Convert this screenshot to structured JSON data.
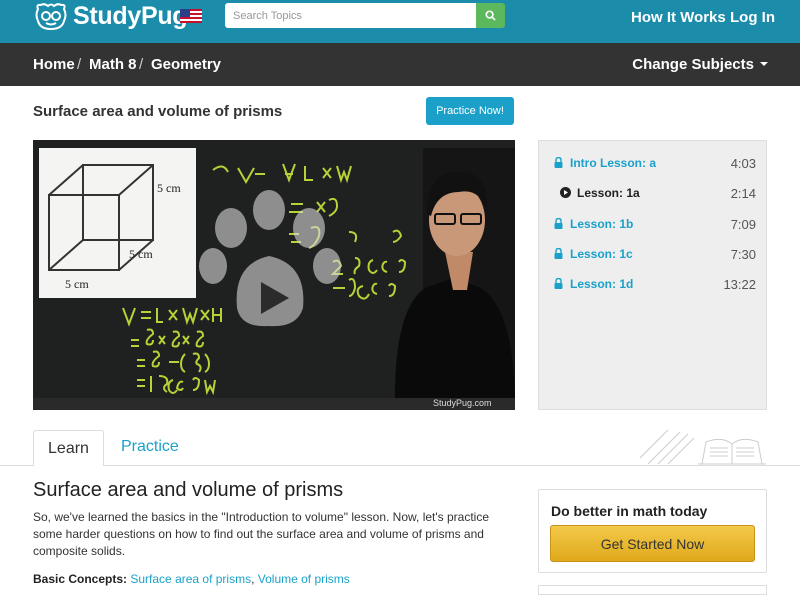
{
  "header": {
    "logo_text": "StudyPug",
    "search_placeholder": "Search Topics",
    "links": [
      "How It Works",
      "Log In"
    ]
  },
  "breadcrumb": [
    "Home",
    "Math 8",
    "Geometry"
  ],
  "change_subjects": "Change Subjects",
  "lesson": {
    "title": "Surface area and volume of prisms",
    "practice_button": "Practice Now!"
  },
  "video": {
    "board_labels": [
      "5 cm",
      "5 cm",
      "5 cm"
    ],
    "watermark": "StudyPug.com"
  },
  "sidebar": {
    "items": [
      {
        "label": "Intro Lesson: a",
        "duration": "4:03",
        "state": "locked"
      },
      {
        "label": "Lesson: 1a",
        "duration": "2:14",
        "state": "playing"
      },
      {
        "label": "Lesson: 1b",
        "duration": "7:09",
        "state": "locked"
      },
      {
        "label": "Lesson: 1c",
        "duration": "7:30",
        "state": "locked"
      },
      {
        "label": "Lesson: 1d",
        "duration": "13:22",
        "state": "locked"
      }
    ]
  },
  "tabs": [
    "Learn",
    "Practice"
  ],
  "content": {
    "heading": "Surface area and volume of prisms",
    "paragraph": "So, we've learned the basics in the \"Introduction to volume\" lesson. Now, let's practice some harder questions on how to find out the surface area and volume of prisms and composite solids.",
    "basic_label": "Basic Concepts:",
    "basic_links": [
      "Surface area of prisms",
      "Volume of prisms"
    ]
  },
  "promo": {
    "title": "Do better in math today",
    "button": "Get Started Now"
  },
  "colors": {
    "topbar": "#1b8dab",
    "navbar": "#333333",
    "accent": "#1ba1c9",
    "cta": "#f0c040"
  },
  "icons": [
    "logo-mascot-icon",
    "us-flag-icon",
    "search-icon",
    "lock-icon",
    "play-icon",
    "book-icon"
  ]
}
